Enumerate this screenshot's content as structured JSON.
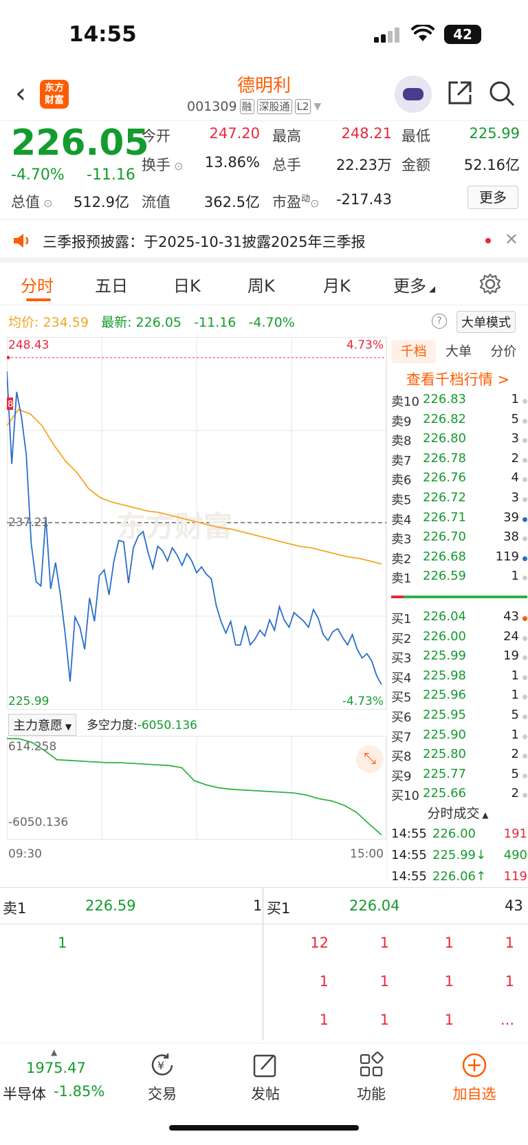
{
  "status": {
    "time": "14:55",
    "battery": "42"
  },
  "header": {
    "back": "‹",
    "logo_line1": "东方",
    "logo_line2": "财富",
    "name": "德明利",
    "code": "001309",
    "tags": [
      "融",
      "深股通",
      "L2"
    ]
  },
  "quote": {
    "price": "226.05",
    "pct": "-4.70%",
    "change": "-11.16",
    "fields": [
      {
        "label": "今开",
        "value": "247.20",
        "color": "#e8283b"
      },
      {
        "label": "最高",
        "value": "248.21",
        "color": "#e8283b"
      },
      {
        "label": "最低",
        "value": "225.99",
        "color": "#149b2d"
      },
      {
        "label": "换手",
        "value": "13.86%",
        "color": "#222"
      },
      {
        "label": "总手",
        "value": "22.23万",
        "color": "#222"
      },
      {
        "label": "金额",
        "value": "52.16亿",
        "color": "#222"
      },
      {
        "label": "总值",
        "value": "512.9亿",
        "color": "#222"
      },
      {
        "label": "流值",
        "value": "362.5亿",
        "color": "#222"
      },
      {
        "label": "市盈",
        "value": "-217.43",
        "color": "#222"
      }
    ],
    "pe_sup": "动",
    "more": "更多"
  },
  "notice": {
    "text": "三季报预披露：于2025-10-31披露2025年三季报"
  },
  "tabs": [
    "分时",
    "五日",
    "日K",
    "周K",
    "月K",
    "更多"
  ],
  "infoline": {
    "avg_label": "均价:",
    "avg": "234.59",
    "latest_label": "最新:",
    "latest": "226.05",
    "change": "-11.16",
    "pct": "-4.70%",
    "big_order_mode": "大单模式",
    "help": "?"
  },
  "chart_data": [
    {
      "type": "line",
      "title": "",
      "y_top_label": "248.43",
      "y_mid_label": "237.21",
      "y_bottom_label": "225.99",
      "pct_top_label": "4.73%",
      "pct_bottom_label": "-4.73%",
      "ylim": [
        225.99,
        248.43
      ],
      "watermark": "东方财富",
      "marker": "8",
      "series": [
        {
          "name": "",
          "color": "#2a6cc9",
          "values": [
            247.5,
            241.2,
            246.1,
            244.4,
            241.8,
            235.8,
            233.2,
            232.9,
            237.6,
            232.7,
            234.5,
            232.3,
            229.6,
            226.4,
            230.8,
            230.1,
            228.6,
            232.1,
            230.5,
            233.6,
            234.0,
            232.3,
            234.6,
            236.0,
            235.9,
            233.1,
            235.5,
            236.3,
            236.6,
            235.2,
            234.1,
            235.6,
            235.3,
            234.6,
            235.5,
            235.0,
            234.3,
            235.1,
            234.6,
            233.8,
            234.2,
            233.7,
            233.4,
            231.6,
            230.5,
            229.7,
            230.5,
            228.9,
            228.9,
            230.2,
            228.9,
            229.3,
            229.9,
            229.5,
            230.6,
            229.9,
            231.5,
            230.6,
            230.1,
            231.1,
            230.8,
            230.5,
            230.1,
            231.3,
            230.7,
            229.6,
            229.2,
            229.8,
            230.0,
            229.4,
            228.9,
            229.6,
            228.6,
            228.0,
            228.3,
            227.8,
            226.8,
            226.2
          ]
        },
        {
          "name": "",
          "color": "#f5a623",
          "values": [
            243.8,
            244.9,
            244.6,
            243.8,
            242.5,
            241.4,
            240.6,
            239.5,
            238.9,
            238.6,
            238.4,
            238.2,
            238.0,
            237.9,
            237.7,
            237.5,
            237.3,
            237.1,
            236.9,
            236.8,
            236.6,
            236.4,
            236.2,
            236.0,
            235.8,
            235.6,
            235.5,
            235.3,
            235.1,
            234.9,
            234.8,
            234.6,
            234.4
          ]
        }
      ]
    },
    {
      "type": "line",
      "title": "主力意愿",
      "indicator_label": "多空力度:",
      "indicator_value": "-6050.136",
      "y_top_label": "614.258",
      "y_bottom_label": "-6050.136",
      "x_start": "09:30",
      "x_end": "15:00",
      "ylim": [
        -6050.136,
        614.258
      ],
      "series": [
        {
          "name": "",
          "color": "#2db144",
          "values": [
            614,
            600,
            350,
            -200,
            -850,
            -900,
            -950,
            -1000,
            -1050,
            -1050,
            -1100,
            -1150,
            -1200,
            -1250,
            -1400,
            -2300,
            -2600,
            -2800,
            -2900,
            -2950,
            -3000,
            -3050,
            -3100,
            -3150,
            -3300,
            -3550,
            -3700,
            -4000,
            -4500,
            -5300,
            -6050
          ]
        }
      ]
    }
  ],
  "orderbook": {
    "tabs": [
      "千档",
      "大单",
      "分价"
    ],
    "link": "查看千档行情 >",
    "sells": [
      {
        "label": "卖10",
        "price": "226.83",
        "vol": "1",
        "dot": "#ccc"
      },
      {
        "label": "卖9",
        "price": "226.82",
        "vol": "5",
        "dot": "#ccc"
      },
      {
        "label": "卖8",
        "price": "226.80",
        "vol": "3",
        "dot": "#ccc"
      },
      {
        "label": "卖7",
        "price": "226.78",
        "vol": "2",
        "dot": "#ccc"
      },
      {
        "label": "卖6",
        "price": "226.76",
        "vol": "4",
        "dot": "#ccc"
      },
      {
        "label": "卖5",
        "price": "226.72",
        "vol": "3",
        "dot": "#ccc"
      },
      {
        "label": "卖4",
        "price": "226.71",
        "vol": "39",
        "dot": "#2a6cc9"
      },
      {
        "label": "卖3",
        "price": "226.70",
        "vol": "38",
        "dot": "#ccc"
      },
      {
        "label": "卖2",
        "price": "226.68",
        "vol": "119",
        "dot": "#2a6cc9"
      },
      {
        "label": "卖1",
        "price": "226.59",
        "vol": "1",
        "dot": "#ccc"
      }
    ],
    "buys": [
      {
        "label": "买1",
        "price": "226.04",
        "vol": "43",
        "dot": "#ff5b00"
      },
      {
        "label": "买2",
        "price": "226.00",
        "vol": "24",
        "dot": "#ccc"
      },
      {
        "label": "买3",
        "price": "225.99",
        "vol": "19",
        "dot": "#ccc"
      },
      {
        "label": "买4",
        "price": "225.98",
        "vol": "1",
        "dot": "#ccc"
      },
      {
        "label": "买5",
        "price": "225.96",
        "vol": "1",
        "dot": "#ccc"
      },
      {
        "label": "买6",
        "price": "225.95",
        "vol": "5",
        "dot": "#ccc"
      },
      {
        "label": "买7",
        "price": "225.90",
        "vol": "1",
        "dot": "#ccc"
      },
      {
        "label": "买8",
        "price": "225.80",
        "vol": "2",
        "dot": "#ccc"
      },
      {
        "label": "买9",
        "price": "225.77",
        "vol": "5",
        "dot": "#ccc"
      },
      {
        "label": "买10",
        "price": "225.66",
        "vol": "2",
        "dot": "#ccc"
      }
    ],
    "trades_title": "分时成交",
    "trades": [
      {
        "time": "14:55",
        "price": "226.00",
        "vol": "191",
        "vcolor": "#e8283b"
      },
      {
        "time": "14:55",
        "price": "225.99↓",
        "vol": "490",
        "vcolor": "#149b2d"
      },
      {
        "time": "14:55",
        "price": "226.06↑",
        "vol": "119",
        "vcolor": "#e8283b"
      }
    ]
  },
  "bottom_panel": {
    "sell_label": "卖1",
    "sell_price": "226.59",
    "sell_vol": "1",
    "buy_label": "买1",
    "buy_price": "226.04",
    "buy_vol": "43",
    "left_rows": [
      [
        "1"
      ]
    ],
    "right_rows": [
      [
        "12",
        "1",
        "1",
        "1"
      ],
      [
        "1",
        "1",
        "1",
        "1"
      ],
      [
        "1",
        "1",
        "1",
        "..."
      ]
    ]
  },
  "nav": {
    "index_value": "1975.47",
    "index_name": "半导体",
    "index_change": "-1.85%",
    "items": [
      {
        "label": "交易"
      },
      {
        "label": "发帖"
      },
      {
        "label": "功能"
      },
      {
        "label": "加自选"
      }
    ]
  }
}
